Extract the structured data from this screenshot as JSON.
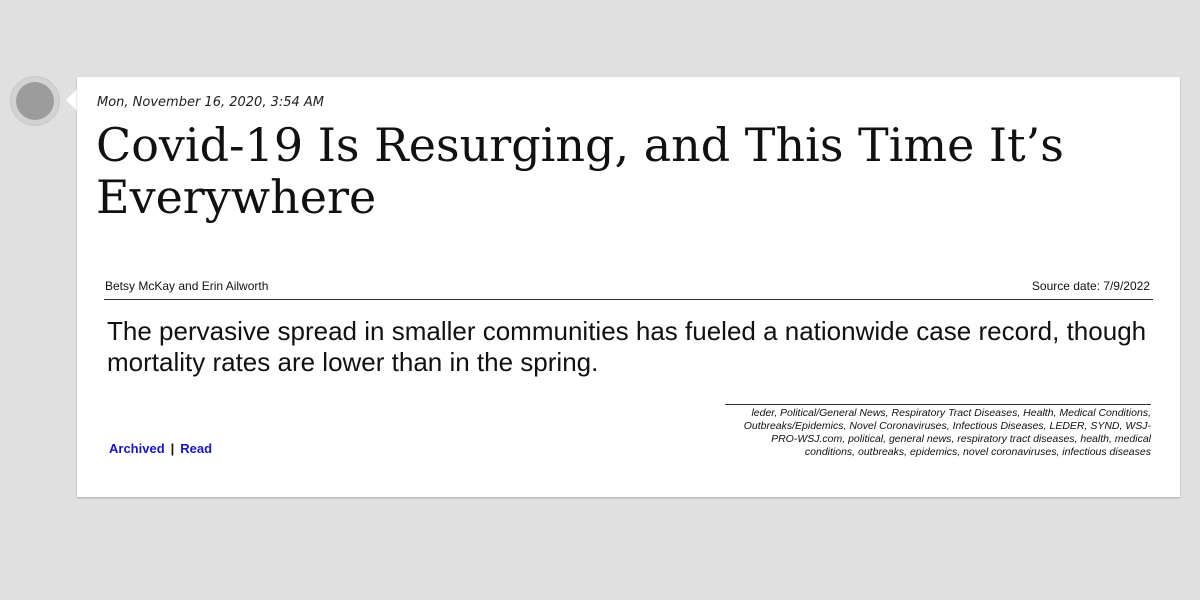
{
  "article": {
    "date": "Mon, November 16, 2020, 3:54 AM",
    "headline": "Covid-19 Is Resurging, and This Time It’s Everywhere",
    "authors": "Betsy McKay and Erin Ailworth",
    "source_date": "Source date: 7/9/2022",
    "summary": "The pervasive spread in smaller communities has fueled a nationwide case record, though mortality rates are lower than in the spring.",
    "tags": "leder, Political/General News, Respiratory Tract Diseases, Health, Medical Conditions, Outbreaks/Epidemics, Novel Coronaviruses, Infectious Diseases, LEDER, SYND, WSJ-PRO-WSJ.com, political, general news, respiratory tract diseases, health, medical conditions, outbreaks, epidemics, novel coronaviruses, infectious diseases"
  },
  "links": {
    "archived": "Archived",
    "separator": "|",
    "read": "Read"
  },
  "colors": {
    "background": "#e0e0e0",
    "card": "#ffffff",
    "link": "#1a14c9",
    "avatar": "#9c9c9c"
  }
}
